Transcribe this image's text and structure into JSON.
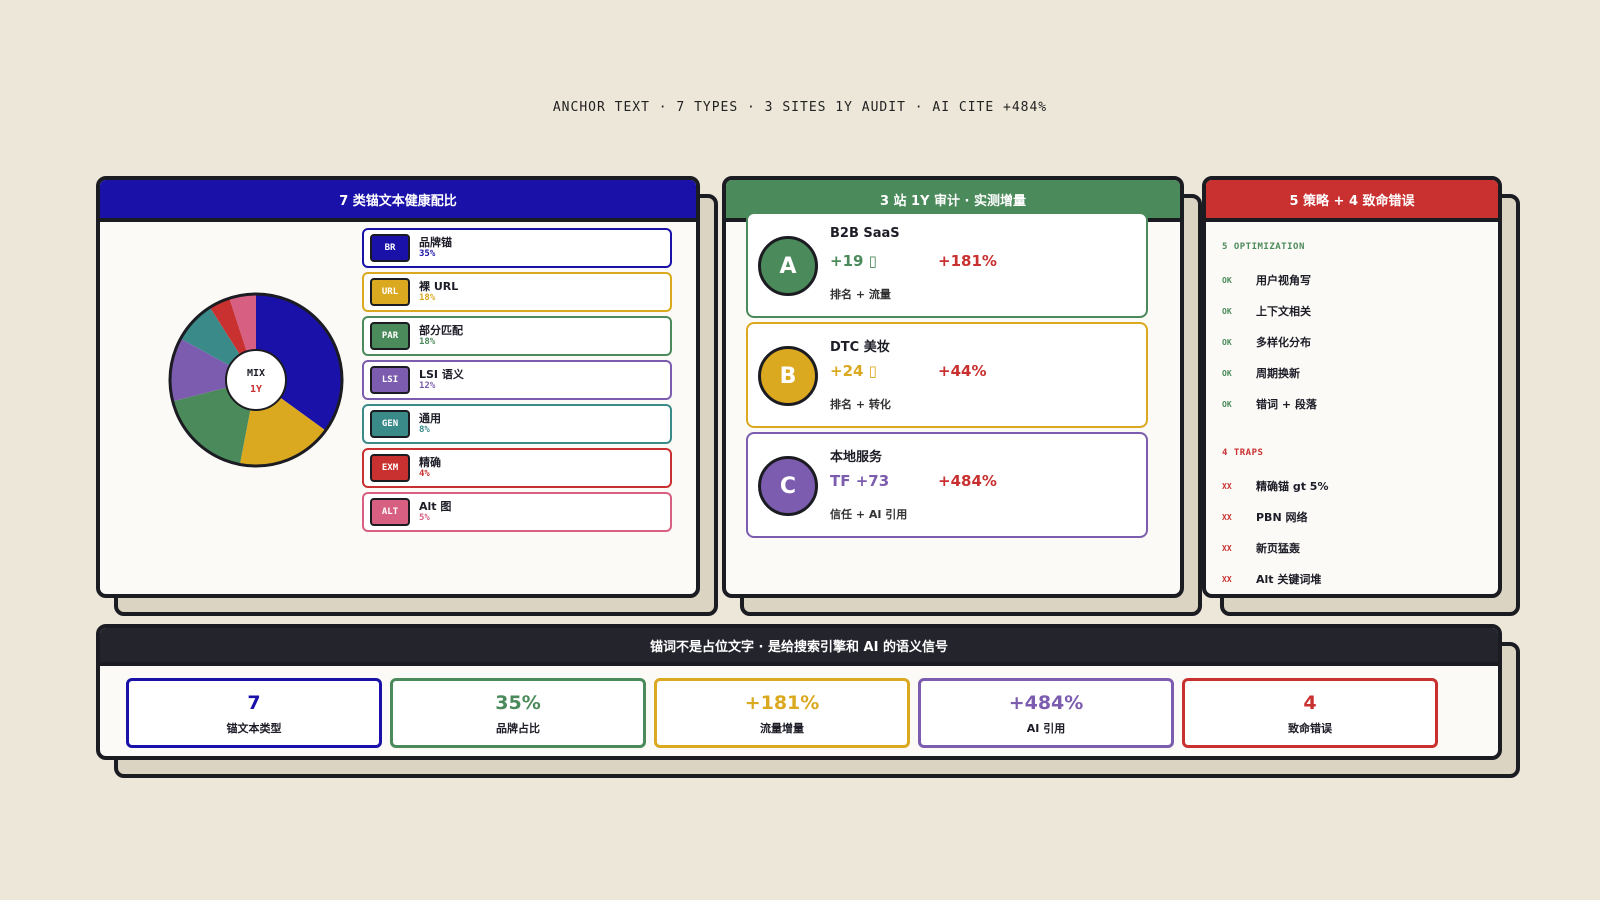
{
  "header": {
    "title": "ANCHOR TEXT · 7 TYPES · 3 SITES 1Y AUDIT · AI CITE +484%"
  },
  "mix_panel": {
    "title": "7 类锚文本健康配比",
    "center_top": "MIX",
    "center_bottom": "1Y",
    "items": [
      {
        "code": "BR",
        "name": "品牌锚",
        "pct": "35%",
        "color": "#1a12a8"
      },
      {
        "code": "URL",
        "name": "裸 URL",
        "pct": "18%",
        "color": "#dba920"
      },
      {
        "code": "PAR",
        "name": "部分匹配",
        "pct": "18%",
        "color": "#4b8a5a"
      },
      {
        "code": "LSI",
        "name": "LSI 语义",
        "pct": "12%",
        "color": "#7c5cae"
      },
      {
        "code": "GEN",
        "name": "通用",
        "pct": "8%",
        "color": "#3a8a8a"
      },
      {
        "code": "EXM",
        "name": "精确",
        "pct": "4%",
        "color": "#c93030"
      },
      {
        "code": "ALT",
        "name": "Alt 图",
        "pct": "5%",
        "color": "#d65f82"
      }
    ]
  },
  "chart_data": {
    "type": "pie",
    "categories": [
      "BR",
      "URL",
      "PAR",
      "LSI",
      "GEN",
      "EXM",
      "ALT"
    ],
    "values": [
      35,
      18,
      18,
      12,
      8,
      4,
      5
    ],
    "colors": [
      "#1a12a8",
      "#dba920",
      "#4b8a5a",
      "#7c5cae",
      "#3a8a8a",
      "#c93030",
      "#d65f82"
    ]
  },
  "audit_panel": {
    "title": "3 站 1Y 审计 · 实测增量",
    "sites": [
      {
        "letter": "A",
        "name": "B2B SaaS",
        "metric": "+19 ▯",
        "growth": "+181%",
        "sub": "排名 + 流量",
        "color": "#4b8a5a"
      },
      {
        "letter": "B",
        "name": "DTC 美妆",
        "metric": "+24 ▯",
        "growth": "+44%",
        "sub": "排名 + 转化",
        "color": "#dba920"
      },
      {
        "letter": "C",
        "name": "本地服务",
        "metric": "TF  +73",
        "growth": "+484%",
        "sub": "信任 + AI 引用",
        "color": "#7c5cae"
      }
    ]
  },
  "strategy_panel": {
    "title": "5 策略 + 4 致命错误",
    "opt_label": "5 OPTIMIZATION",
    "ok_mark": "OK",
    "optimizations": [
      "用户视角写",
      "上下文相关",
      "多样化分布",
      "周期换新",
      "错词 + 段落"
    ],
    "trap_label": "4 TRAPS",
    "trap_mark": "XX",
    "traps": [
      "精确锚 gt 5%",
      "PBN 网络",
      "新页猛轰",
      "Alt 关键词堆"
    ]
  },
  "summary_panel": {
    "title": "锚词不是占位文字 · 是给搜索引擎和 AI 的语义信号",
    "stats": [
      {
        "value": "7",
        "label": "锚文本类型",
        "color": "#1a12a8"
      },
      {
        "value": "35%",
        "label": "品牌占比",
        "color": "#4b8a5a"
      },
      {
        "value": "+181%",
        "label": "流量增量",
        "color": "#dba920"
      },
      {
        "value": "+484%",
        "label": "AI 引用",
        "color": "#7c5cae"
      },
      {
        "value": "4",
        "label": "致命错误",
        "color": "#c93030"
      }
    ]
  }
}
